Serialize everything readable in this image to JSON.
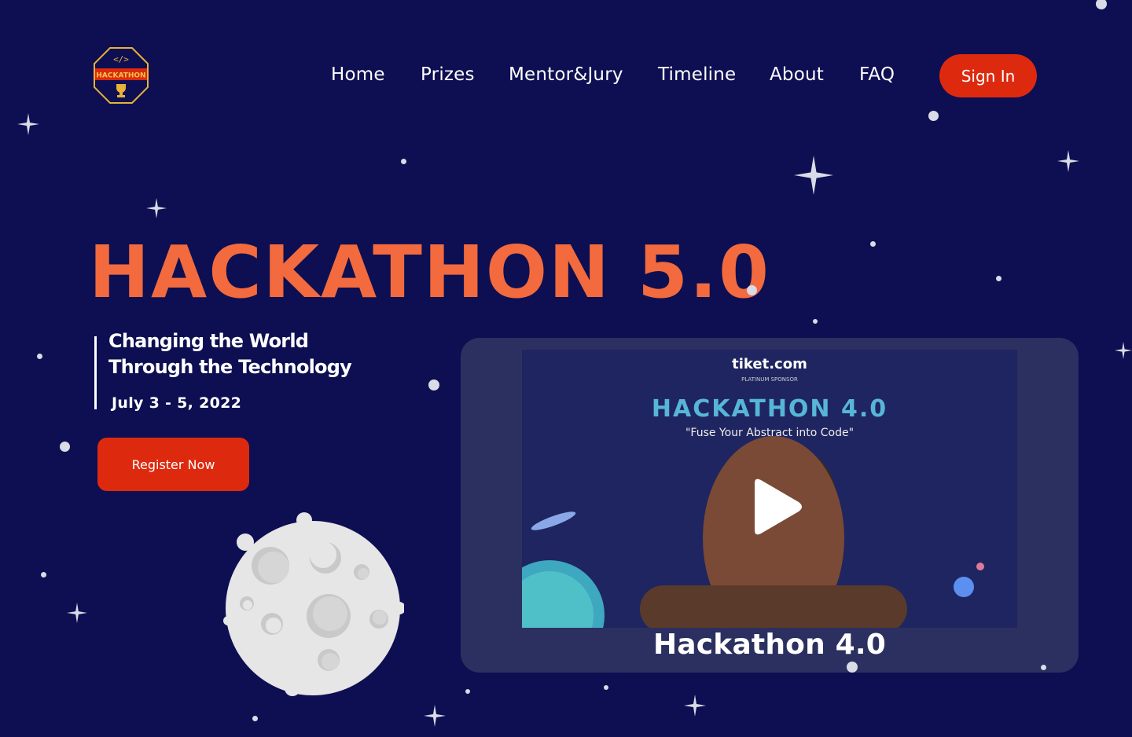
{
  "header": {
    "logo_text": "HACKATHON",
    "nav": [
      "Home",
      "Prizes",
      "Mentor&Jury",
      "Timeline",
      "About",
      "FAQ"
    ],
    "sign_in_label": "Sign In"
  },
  "hero": {
    "title": "HACKATHON 5.0",
    "tagline": "Changing the World Through the Technology",
    "dates": "July 3 - 5, 2022",
    "register_label": "Register Now"
  },
  "video": {
    "caption": "Hackathon 4.0",
    "thumb_title": "HACKATHON 4.0",
    "thumb_subtitle": "\"Fuse Your Abstract into Code\"",
    "sponsor": "tiket.com",
    "sponsor_tag": "PLATINUM SPONSOR"
  },
  "colors": {
    "background": "#0d0f52",
    "accent": "#f26a3d",
    "button": "#dd2a0e"
  }
}
